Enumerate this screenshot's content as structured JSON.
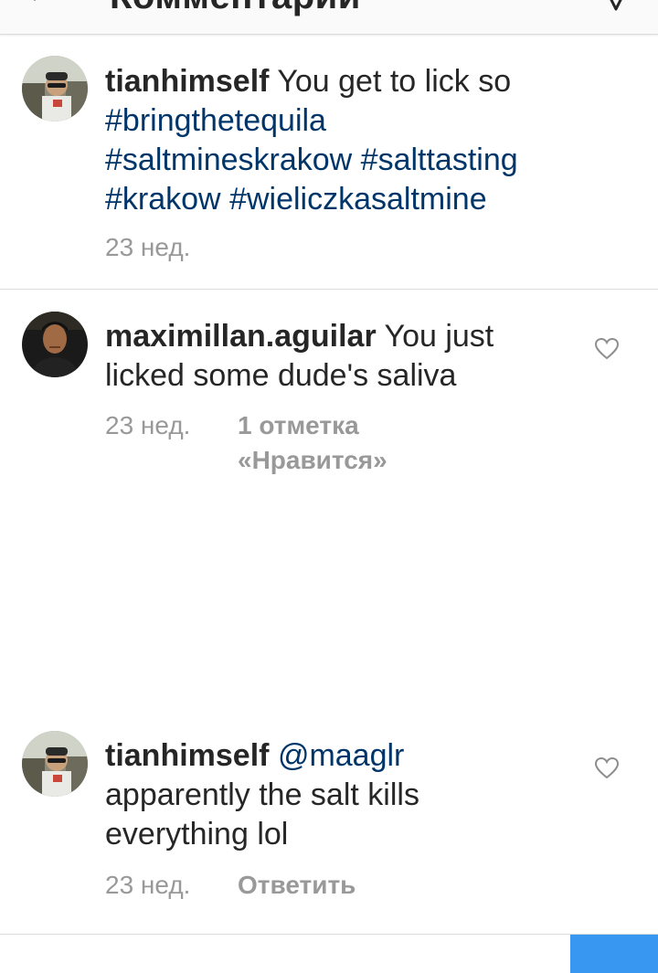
{
  "header": {
    "title": "Комментарии",
    "back_icon": "arrow-left-icon",
    "send_icon": "paper-plane-icon"
  },
  "comments": [
    {
      "username": "tianhimself",
      "text": "You get to lick so",
      "tags": [
        "#bringthetequila",
        "#saltmineskrakow",
        "#salttasting",
        "#krakow",
        "#wieliczkasaltmine"
      ],
      "time": "23 нед."
    },
    {
      "username": "maximillan.aguilar",
      "text": "You just licked some dude's saliva",
      "time": "23 нед.",
      "likes_line1": "1 отметка",
      "likes_line2": "«Нравится»"
    },
    {
      "username": "tianhimself",
      "mention": "@maaglr",
      "text": "apparently the salt kills everything lol",
      "time": "23 нед.",
      "reply_label": "Ответить"
    }
  ],
  "colors": {
    "text": "#262626",
    "link": "#003569",
    "meta": "#999999",
    "divider": "#dbdbdb",
    "accent": "#3897f0"
  }
}
